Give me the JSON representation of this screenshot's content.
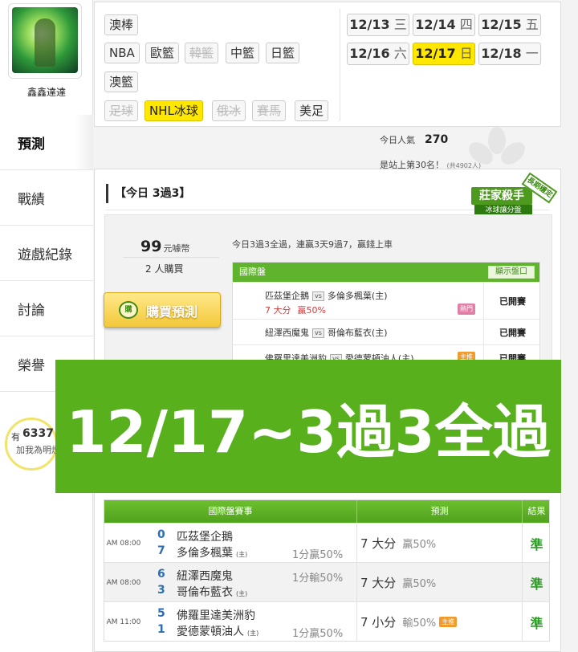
{
  "sidebar": {
    "user_name": "鑫鑫達達",
    "nav": [
      "預測",
      "戰績",
      "遊戲紀錄",
      "討論",
      "榮譽"
    ],
    "fans": {
      "prefix": "有",
      "count": "6337",
      "add_label": "加我為明燈"
    }
  },
  "filters": {
    "row1": [
      "澳棒"
    ],
    "row2": [
      "NBA",
      "歐籃",
      "韓籃",
      "中籃",
      "日籃"
    ],
    "row3": [
      "澳籃"
    ],
    "row4": [
      "足球",
      "NHL冰球",
      "俄冰",
      "賽馬",
      "美足"
    ],
    "selected": "NHL冰球",
    "disabled": [
      "韓籃",
      "足球",
      "俄冰",
      "賽馬"
    ]
  },
  "dates": [
    {
      "date": "12/13",
      "day": "三"
    },
    {
      "date": "12/14",
      "day": "四"
    },
    {
      "date": "12/15",
      "day": "五"
    },
    {
      "date": "12/16",
      "day": "六"
    },
    {
      "date": "12/17",
      "day": "日",
      "selected": true
    },
    {
      "date": "12/18",
      "day": "一"
    }
  ],
  "stats": {
    "popularity_label": "今日人氣",
    "popularity_value": "270",
    "rank_text": "是站上第30名！",
    "rank_note": "(共4902人)"
  },
  "card": {
    "title": "【今日 3過3】",
    "badge_main": "莊家殺手",
    "badge_sub": "冰球讓分盤",
    "badge_ribbon": "長期穩定",
    "price": "99",
    "price_unit": "元噱幣",
    "buyers": "2 人購買",
    "buy_icon": "購",
    "buy_label": "購買預測",
    "intro": "今日3過3全過，連贏3天9過7，贏錢上車",
    "table_head": "國際盤",
    "show_label": "顯示盤口",
    "vs": "vs",
    "rows": [
      {
        "home": "匹茲堡企鵝",
        "away": "多倫多楓葉(主)",
        "pick": "7 大分",
        "rate": "贏50%",
        "tag": "熱門",
        "status": "已開賽"
      },
      {
        "home": "紐澤西魔鬼",
        "away": "哥倫布藍衣(主)",
        "status": "已開賽"
      },
      {
        "home": "佛羅里達美洲豹",
        "away": "愛德蒙頓油人(主)",
        "tag": "主推",
        "status": "已開賽"
      }
    ]
  },
  "banner": {
    "text": "12/17~3過3全過"
  },
  "results": {
    "headers": [
      "國際盤賽事",
      "預測",
      "結果"
    ],
    "rows": [
      {
        "time": "AM 08:00",
        "score1": "0",
        "team1": "匹茲堡企鵝",
        "score2": "7",
        "team2": "多倫多楓葉",
        "home_mark": "(主)",
        "line": "1分贏50%",
        "pick": "7 大分",
        "rate": "贏50%",
        "result": "準"
      },
      {
        "time": "AM 08:00",
        "score1": "6",
        "team1": "紐澤西魔鬼",
        "score2": "3",
        "team2": "哥倫布藍衣",
        "home_mark": "(主)",
        "line": "1分輸50%",
        "pick": "7 大分",
        "rate": "贏50%",
        "result": "準"
      },
      {
        "time": "AM 11:00",
        "score1": "5",
        "team1": "佛羅里達美洲豹",
        "score2": "1",
        "team2": "愛德蒙頓油人",
        "home_mark": "(主)",
        "line": "1分贏50%",
        "pick": "7 小分",
        "rate": "輸50%",
        "tag": "主推",
        "result": "準"
      }
    ]
  },
  "colors": {
    "accent_green": "#57b01c",
    "selected_yellow": "#ffe700",
    "score_blue": "#2a6fb5"
  }
}
